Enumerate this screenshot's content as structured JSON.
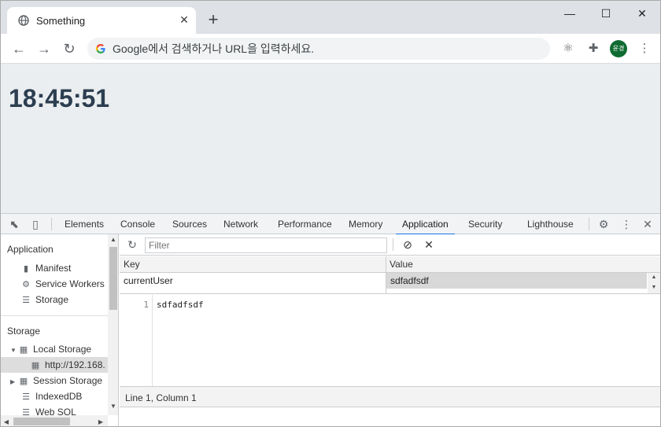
{
  "browser": {
    "tab_title": "Something",
    "omnibox_placeholder": "Google에서 검색하거나 URL을 입력하세요.",
    "avatar_text": "윤경"
  },
  "page": {
    "clock": "18:45:51"
  },
  "devtools": {
    "tabs": [
      "Elements",
      "Console",
      "Sources",
      "Network",
      "Performance",
      "Memory",
      "Application",
      "Security",
      "Lighthouse"
    ],
    "active_tab": "Application",
    "sidebar": {
      "application_header": "Application",
      "application_items": [
        "Manifest",
        "Service Workers",
        "Storage"
      ],
      "storage_header": "Storage",
      "local_storage": "Local Storage",
      "local_storage_origin": "http://192.168.",
      "session_storage": "Session Storage",
      "indexeddb": "IndexedDB",
      "websql": "Web SQL"
    },
    "filter_placeholder": "Filter",
    "table": {
      "headers": [
        "Key",
        "Value"
      ],
      "rows": [
        {
          "key": "currentUser",
          "value": "sdfadfsdf"
        }
      ]
    },
    "editor": {
      "line_number": "1",
      "content": "sdfadfsdf"
    },
    "status": "Line 1, Column 1"
  },
  "colors": {
    "accent": "#1a73e8",
    "clock": "#2c3e50",
    "page_bg": "#ebeef0",
    "avatar_bg": "#0f6b32"
  }
}
